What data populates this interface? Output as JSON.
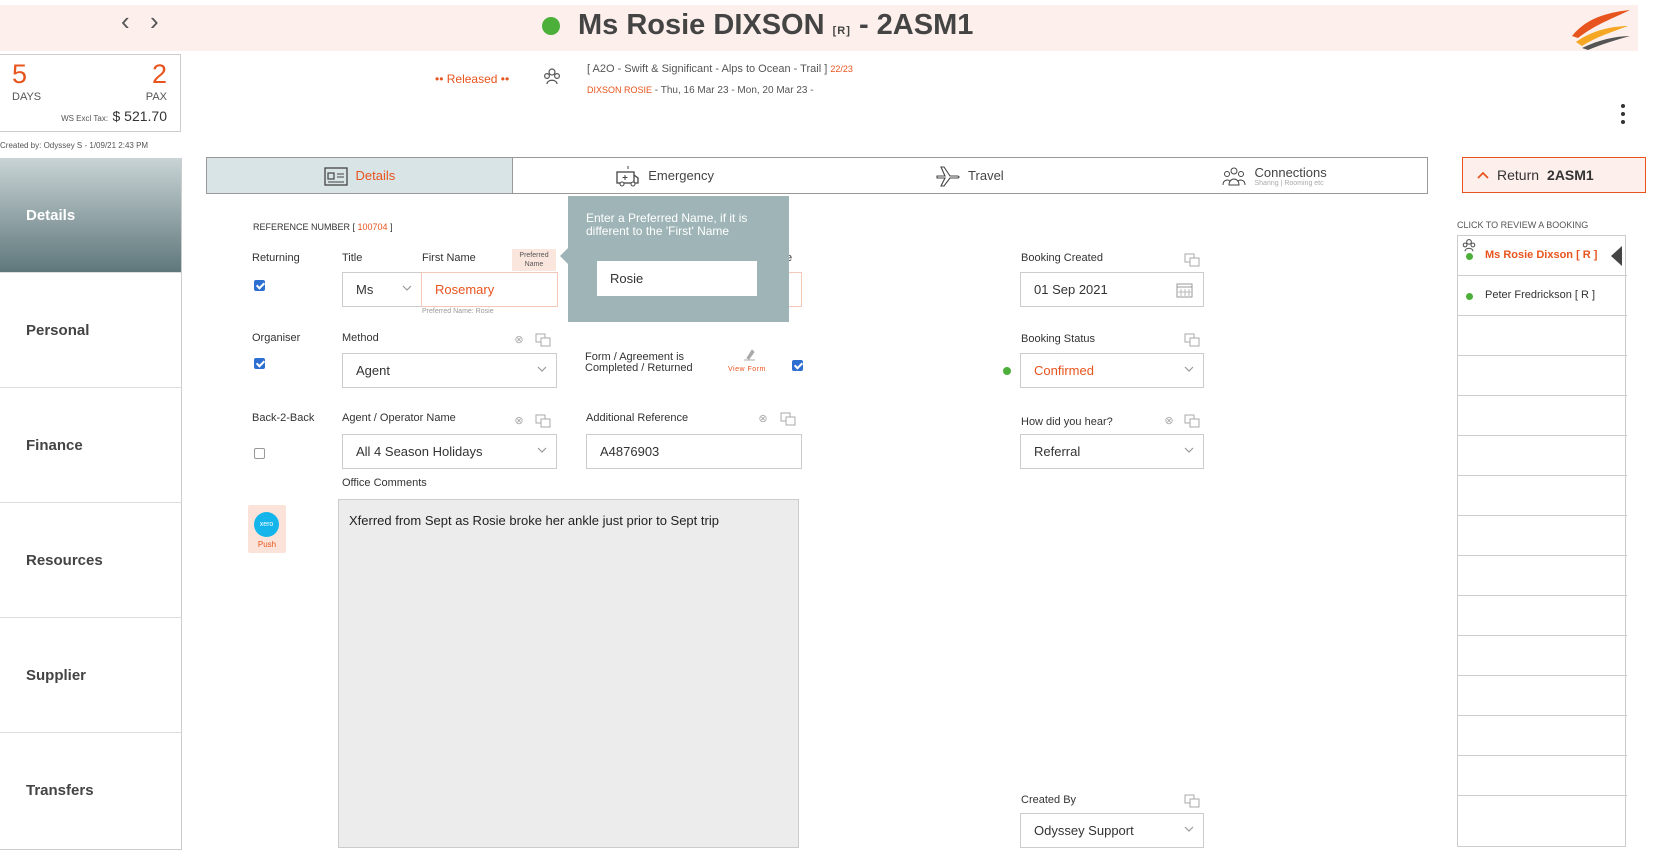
{
  "header": {
    "title_name": "Ms Rosie DIXSON",
    "title_sup": "[R]",
    "title_code": "- 2ASM1",
    "prev_label": "‹",
    "next_label": "›"
  },
  "summary": {
    "days_value": "5",
    "days_label": "DAYS",
    "pax_value": "2",
    "pax_label": "PAX",
    "ws_label": "WS Excl Tax:",
    "ws_value": "$ 521.70",
    "created_by": "Created by: Odyssey S - 1/09/21 2:43 PM"
  },
  "sidebar": {
    "items": [
      {
        "label": "Details"
      },
      {
        "label": "Personal"
      },
      {
        "label": "Finance"
      },
      {
        "label": "Resources"
      },
      {
        "label": "Supplier"
      },
      {
        "label": "Transfers"
      }
    ]
  },
  "info": {
    "released": "•• Released ••",
    "trip": "[ A2O - Swift & Significant - Alps to Ocean - Trail ]",
    "trip_count": "22/23",
    "name_upper": "DIXSON ROSIE",
    "dates": "- Thu, 16 Mar 23 - Mon, 20 Mar 23 -"
  },
  "tabs": [
    {
      "label": "Details",
      "sub": ""
    },
    {
      "label": "Emergency",
      "sub": ""
    },
    {
      "label": "Travel",
      "sub": ""
    },
    {
      "label": "Connections",
      "sub": "Sharing | Rooming etc"
    }
  ],
  "return_btn": {
    "label": "Return",
    "code": "2ASM1"
  },
  "form": {
    "reference_label": "REFERENCE NUMBER [",
    "reference_value": "100704",
    "reference_close": "]",
    "returning_label": "Returning",
    "title_label": "Title",
    "title_value": "Ms",
    "first_name_label": "First Name",
    "first_name_value": "Rosemary",
    "preferred_hint": "Preferred Name: Rosie",
    "preferred_badge": "Preferred Name",
    "last_label_tail": "e",
    "organiser_label": "Organiser",
    "method_label": "Method",
    "method_value": "Agent",
    "form_agreement_label": "Form / Agreement is Completed / Returned",
    "view_form": "View Form",
    "back2back_label": "Back-2-Back",
    "agent_label": "Agent / Operator Name",
    "agent_value": "All 4 Season Holidays",
    "additional_ref_label": "Additional Reference",
    "additional_ref_value": "A4876903",
    "office_comments_label": "Office Comments",
    "office_comments_value": "Xferred from Sept as Rosie broke her ankle just prior to Sept trip",
    "booking_created_label": "Booking Created",
    "booking_created_value": "01 Sep 2021",
    "booking_status_label": "Booking Status",
    "booking_status_value": "Confirmed",
    "hear_label": "How did you hear?",
    "hear_value": "Referral",
    "created_by_label": "Created By",
    "created_by_value": "Odyssey Support"
  },
  "tooltip": {
    "text": "Enter a Preferred Name, if it is different to the 'First' Name",
    "value": "Rosie"
  },
  "xero": {
    "logo": "xero",
    "push": "Push"
  },
  "review": {
    "label": "CLICK TO REVIEW A BOOKING",
    "items": [
      {
        "name": "Ms Rosie Dixson  [ R ]"
      },
      {
        "name": "Peter Fredrickson  [ R ]"
      }
    ]
  },
  "colors": {
    "accent": "#e8541e",
    "status_green": "#4caf3a",
    "active_tab": "#d8e4e6"
  }
}
